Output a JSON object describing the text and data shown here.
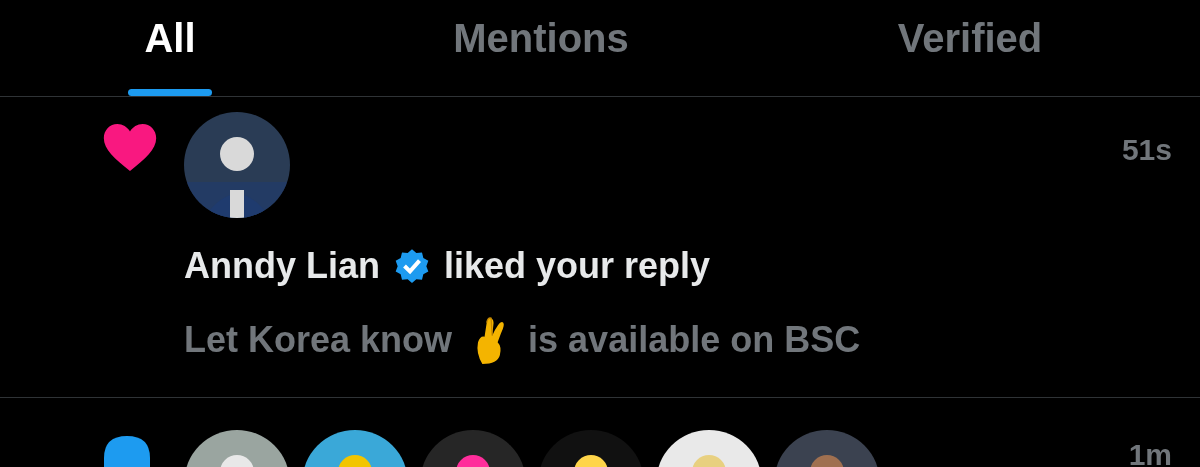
{
  "tabs": [
    {
      "label": "All",
      "selected": true
    },
    {
      "label": "Mentions",
      "selected": false
    },
    {
      "label": "Verified",
      "selected": false
    }
  ],
  "notifications": [
    {
      "kind": "like",
      "time": "51s",
      "user": "Anndy Lian",
      "verified": true,
      "action": "liked your reply",
      "message": [
        "Let Korea know",
        "is available on BSC"
      ]
    },
    {
      "kind": "follow",
      "time": "1m"
    }
  ]
}
